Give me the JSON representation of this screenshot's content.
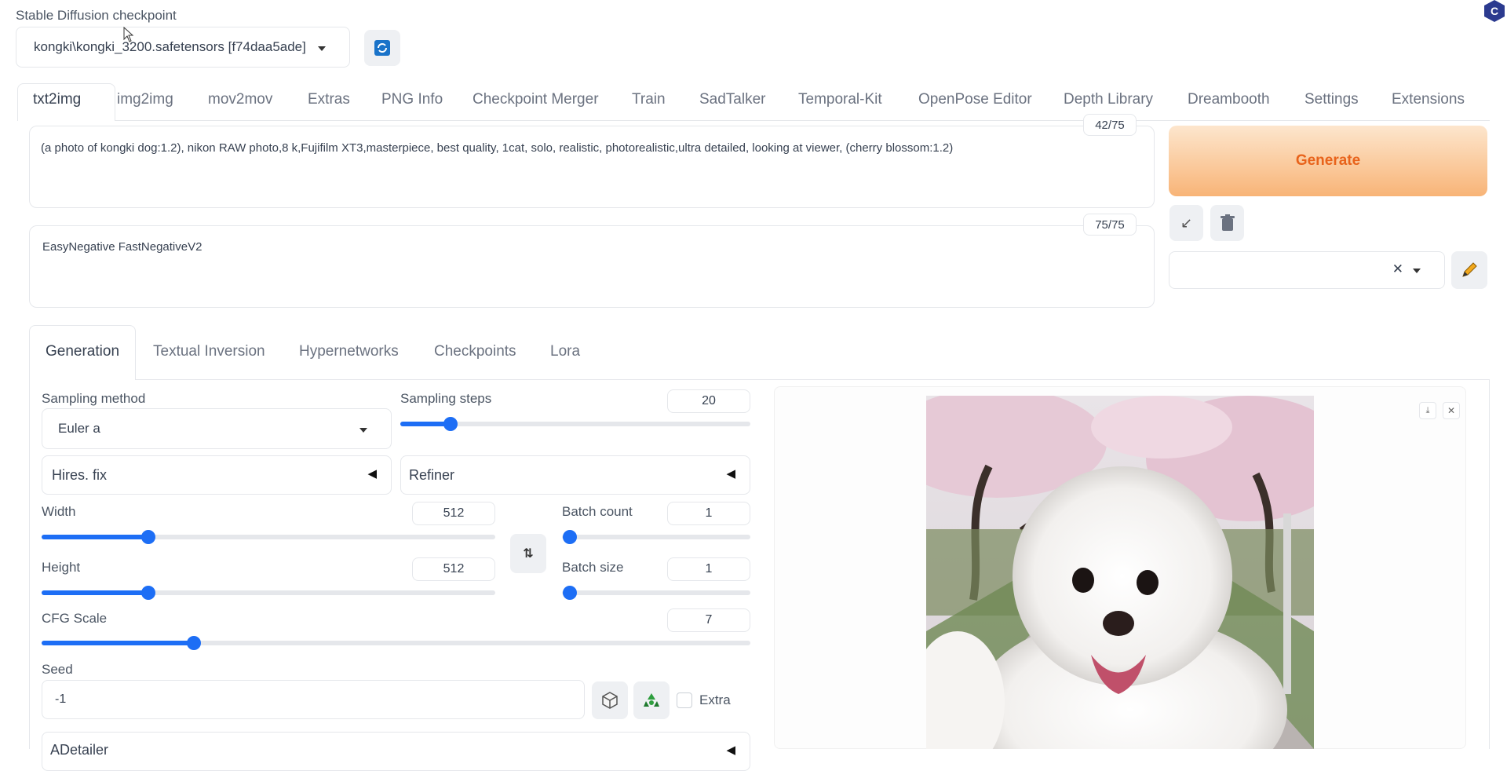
{
  "checkpoint": {
    "label": "Stable Diffusion checkpoint",
    "value": "kongki\\kongki_3200.safetensors [f74daa5ade]"
  },
  "tabs": [
    "txt2img",
    "img2img",
    "mov2mov",
    "Extras",
    "PNG Info",
    "Checkpoint Merger",
    "Train",
    "SadTalker",
    "Temporal-Kit",
    "OpenPose Editor",
    "Depth Library",
    "Dreambooth",
    "Settings",
    "Extensions"
  ],
  "prompt": {
    "text": "(a photo of kongki dog:1.2), nikon RAW photo,8 k,Fujifilm XT3,masterpiece, best quality, 1cat, solo, realistic, photorealistic,ultra detailed, looking at viewer, (cherry blossom:1.2)",
    "token_count": "42/75"
  },
  "negative_prompt": {
    "text": "EasyNegative FastNegativeV2",
    "token_count": "75/75"
  },
  "generate_label": "Generate",
  "subtabs": [
    "Generation",
    "Textual Inversion",
    "Hypernetworks",
    "Checkpoints",
    "Lora"
  ],
  "sampling": {
    "method_label": "Sampling method",
    "method_value": "Euler a",
    "steps_label": "Sampling steps",
    "steps_value": "20"
  },
  "hires_label": "Hires. fix",
  "refiner_label": "Refiner",
  "width": {
    "label": "Width",
    "value": "512"
  },
  "height": {
    "label": "Height",
    "value": "512"
  },
  "batch_count": {
    "label": "Batch count",
    "value": "1"
  },
  "batch_size": {
    "label": "Batch size",
    "value": "1"
  },
  "cfg": {
    "label": "CFG Scale",
    "value": "7"
  },
  "seed": {
    "label": "Seed",
    "value": "-1",
    "extra_label": "Extra"
  },
  "adetailer_label": "ADetailer",
  "colors": {
    "accent": "#1d6ef5",
    "generate_start": "#fde0c2",
    "generate_end": "#f7a85a",
    "generate_text": "#e8631b"
  }
}
